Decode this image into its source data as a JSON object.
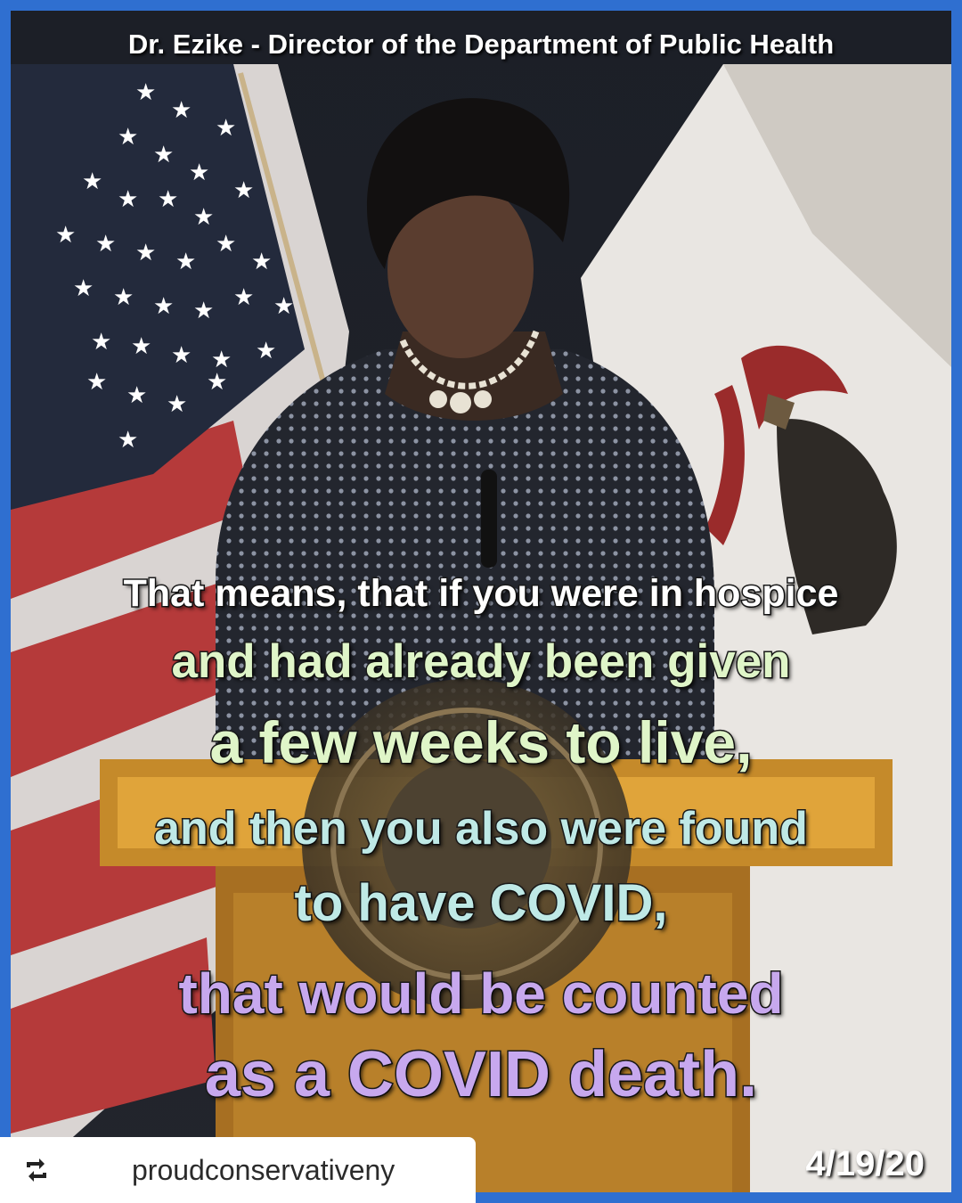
{
  "header": {
    "title": "Dr. Ezike - Director of the Department of Public Health"
  },
  "subtitles": {
    "line1": "That means, that if you were in hospice",
    "line2": "and had already been given",
    "line3": "a few weeks to live,",
    "line4": "and then you also were found",
    "line5": "to have COVID,",
    "line6": "that would be counted",
    "line7": "as a COVID death."
  },
  "date": "4/19/20",
  "repost": {
    "icon": "repost-icon",
    "username": "proudconservativeny"
  },
  "colors": {
    "frame_border": "#2f6fd0",
    "subtitle_green": "#dff5c8",
    "subtitle_teal": "#bfe9e6",
    "subtitle_purple": "#c7a8ee"
  }
}
